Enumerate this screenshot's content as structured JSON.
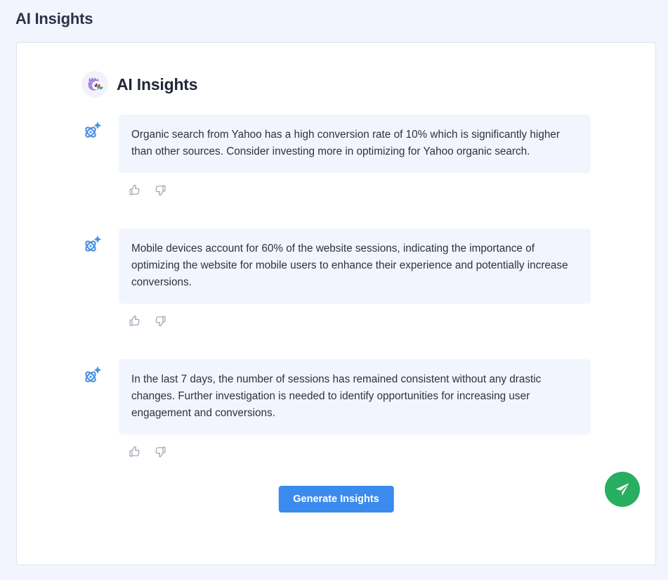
{
  "page": {
    "title": "AI Insights",
    "background_color": "#f2f5fd"
  },
  "card": {
    "header": {
      "title": "AI Insights",
      "avatar_icon": "mascot-avatar"
    },
    "insights": [
      {
        "icon": "ai-sparkle-atom-icon",
        "text": "Organic search from Yahoo has a high conversion rate of 10% which is significantly higher than other sources. Consider investing more in optimizing for Yahoo organic search.",
        "thumbs_up_icon": "thumbs-up-icon",
        "thumbs_down_icon": "thumbs-down-icon"
      },
      {
        "icon": "ai-sparkle-atom-icon",
        "text": "Mobile devices account for 60% of the website sessions, indicating the importance of optimizing the website for mobile users to enhance their experience and potentially increase conversions.",
        "thumbs_up_icon": "thumbs-up-icon",
        "thumbs_down_icon": "thumbs-down-icon"
      },
      {
        "icon": "ai-sparkle-atom-icon",
        "text": "In the last 7 days, the number of sessions has remained consistent without any drastic changes. Further investigation is needed to identify opportunities for increasing user engagement and conversions.",
        "thumbs_up_icon": "thumbs-up-icon",
        "thumbs_down_icon": "thumbs-down-icon"
      }
    ],
    "footer": {
      "generate_label": "Generate Insights",
      "send_icon": "send-paper-plane-icon"
    }
  },
  "colors": {
    "accent_blue": "#3b8bef",
    "ai_icon_blue": "#4a90e2",
    "send_green": "#27ae60",
    "bubble_bg": "#f2f5fd",
    "text_primary": "#2c3242",
    "card_border": "#dde4ee"
  }
}
